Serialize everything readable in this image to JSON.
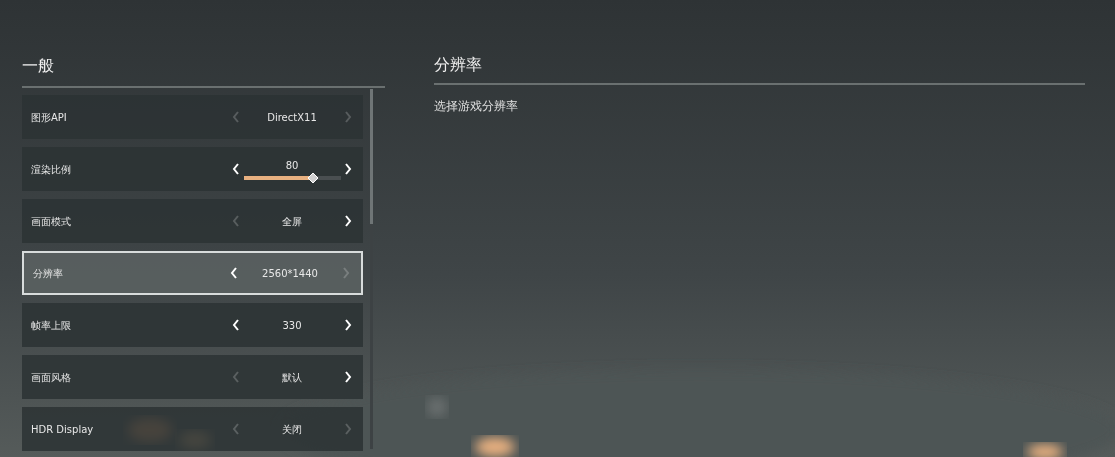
{
  "section_title": "一般",
  "settings": [
    {
      "kind": "choice",
      "label": "图形API",
      "value": "DirectX11",
      "prev_enabled": false,
      "next_enabled": false,
      "selected": false
    },
    {
      "kind": "slider",
      "label": "渲染比例",
      "value": "80",
      "level": 0.72,
      "prev_enabled": true,
      "next_enabled": true,
      "selected": false
    },
    {
      "kind": "choice",
      "label": "画面模式",
      "value": "全屏",
      "prev_enabled": false,
      "next_enabled": true,
      "selected": false
    },
    {
      "kind": "choice",
      "label": "分辨率",
      "value": "2560*1440",
      "prev_enabled": true,
      "next_enabled": false,
      "selected": true
    },
    {
      "kind": "choice",
      "label": "帧率上限",
      "value": "330",
      "prev_enabled": true,
      "next_enabled": true,
      "selected": false
    },
    {
      "kind": "choice",
      "label": "画面风格",
      "value": "默认",
      "prev_enabled": false,
      "next_enabled": true,
      "selected": false
    },
    {
      "kind": "choice",
      "label": "HDR Display",
      "value": "关闭",
      "prev_enabled": false,
      "next_enabled": false,
      "selected": false
    }
  ],
  "detail": {
    "title": "分辨率",
    "description": "选择游戏分辨率"
  }
}
